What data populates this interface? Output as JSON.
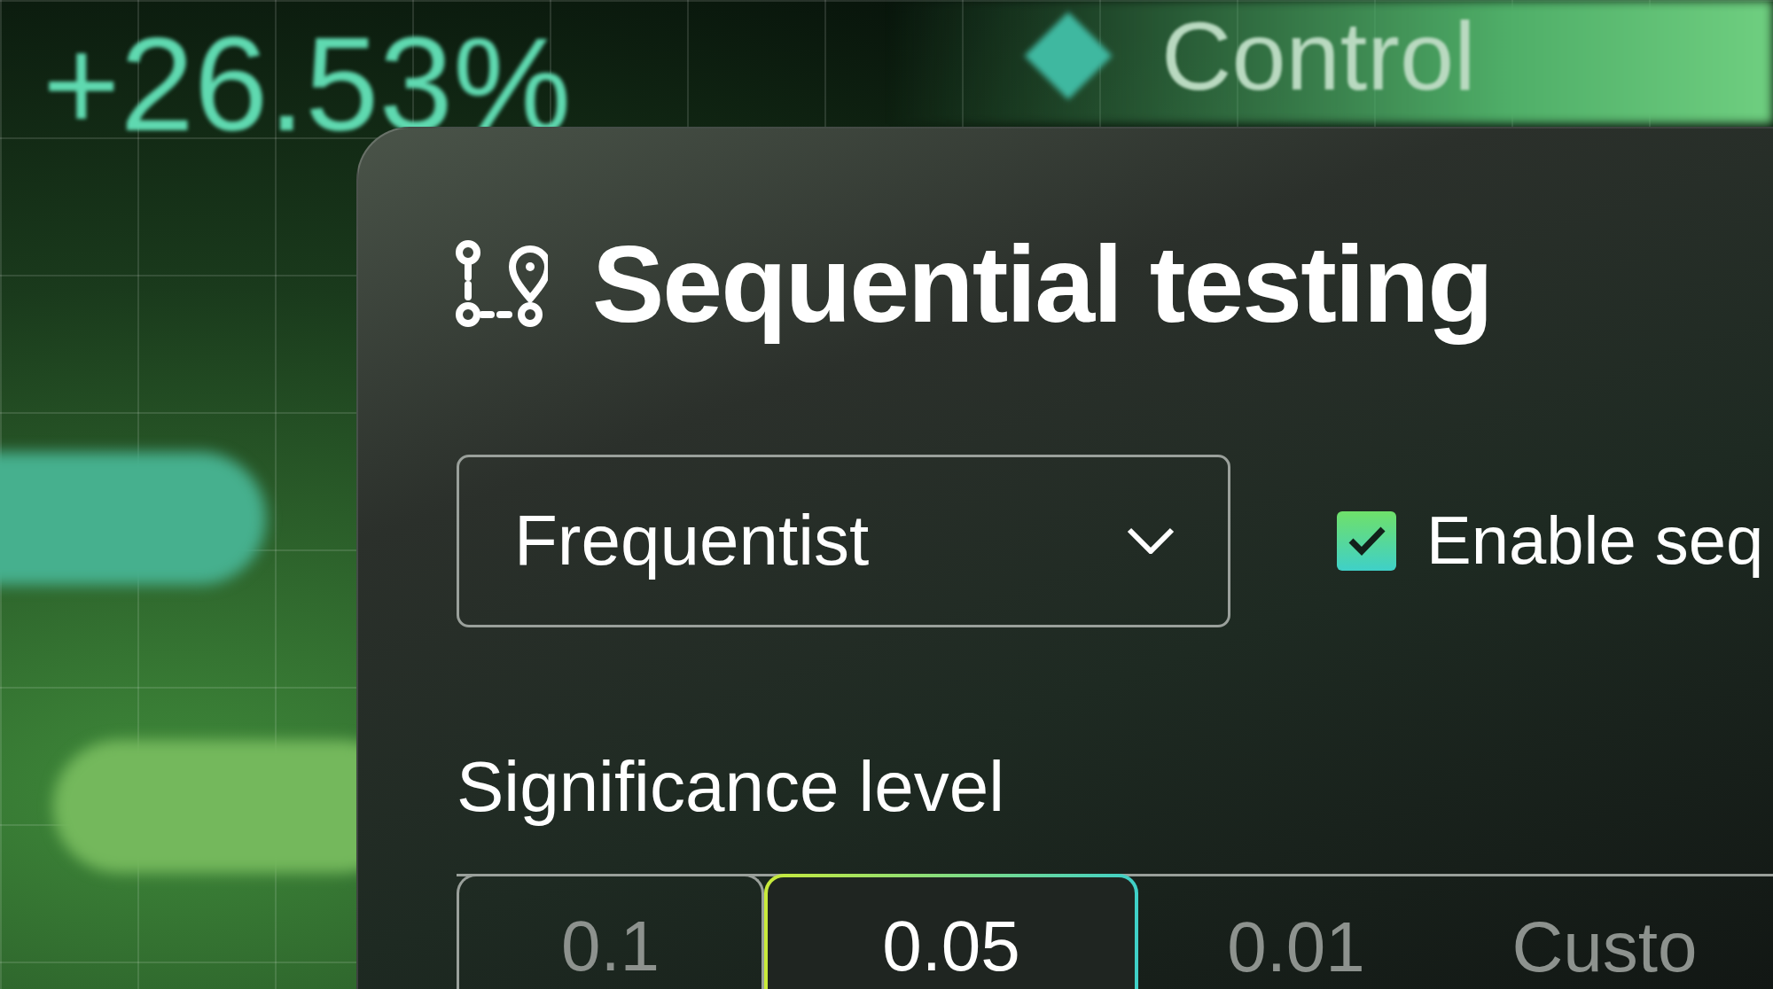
{
  "background": {
    "metric": "+26.53%",
    "legend": {
      "label": "Control"
    }
  },
  "panel": {
    "title": "Sequential testing",
    "method": {
      "value": "Frequentist"
    },
    "sequential": {
      "label": "Enable seq",
      "checked": true
    },
    "significance": {
      "label": "Significance level",
      "options": [
        {
          "label": "0.1",
          "selected": false
        },
        {
          "label": "0.05",
          "selected": true
        },
        {
          "label": "0.01",
          "selected": false
        },
        {
          "label": "Custo",
          "selected": false
        }
      ]
    }
  }
}
